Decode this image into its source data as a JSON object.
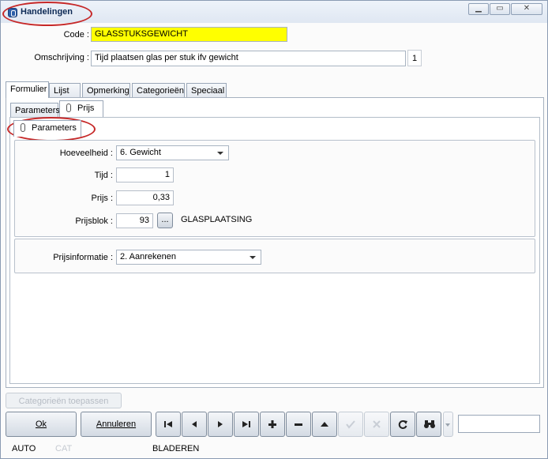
{
  "window": {
    "title": "Handelingen"
  },
  "fields": {
    "code_label": "Code :",
    "code_value": "GLASSTUKSGEWICHT",
    "desc_label": "Omschrijving :",
    "desc_value": "Tijd plaatsen glas per stuk ifv gewicht",
    "desc_count": "1"
  },
  "tabs": [
    "Formulier",
    "Lijst",
    "Opmerking",
    "Categorieën",
    "Speciaal"
  ],
  "subtabs": [
    "Parameters",
    "Prijs"
  ],
  "subsubtab": "Parameters",
  "params": {
    "hoeveelheid_label": "Hoeveelheid :",
    "hoeveelheid_value": "6.  Gewicht",
    "tijd_label": "Tijd :",
    "tijd_value": "1",
    "prijs_label": "Prijs :",
    "prijs_value": "0,33",
    "prijsblok_label": "Prijsblok :",
    "prijsblok_value": "93",
    "prijsblok_button": "...",
    "prijsblok_name": "GLASPLAATSING",
    "prijsinfo_label": "Prijsinformatie :",
    "prijsinfo_value": "2.  Aanrekenen"
  },
  "buttons": {
    "categorieen": "Categorieën toepassen",
    "ok": "Ok",
    "annuleren": "Annuleren"
  },
  "status": {
    "auto": "AUTO",
    "cat": "CAT",
    "mode": "BLADEREN"
  }
}
